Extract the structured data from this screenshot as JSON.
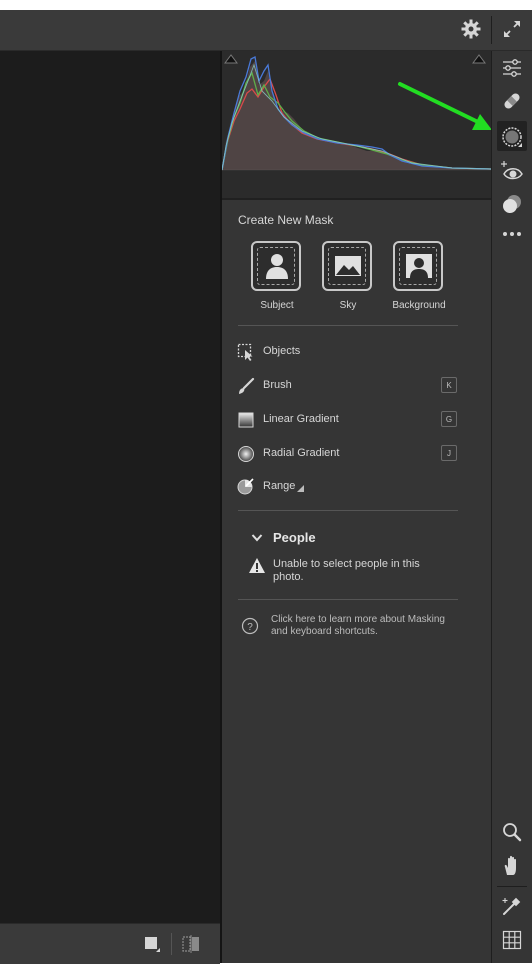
{
  "mask_panel": {
    "title": "Create New Mask",
    "quick_masks": [
      {
        "label": "Subject",
        "icon": "subject-icon"
      },
      {
        "label": "Sky",
        "icon": "sky-icon"
      },
      {
        "label": "Background",
        "icon": "background-icon"
      }
    ],
    "tools": [
      {
        "label": "Objects",
        "icon": "objects-icon",
        "shortcut": ""
      },
      {
        "label": "Brush",
        "icon": "brush-icon",
        "shortcut": "K"
      },
      {
        "label": "Linear Gradient",
        "icon": "linear-gradient-icon",
        "shortcut": "G"
      },
      {
        "label": "Radial Gradient",
        "icon": "radial-gradient-icon",
        "shortcut": "J"
      },
      {
        "label": "Range",
        "icon": "range-icon",
        "shortcut": ""
      }
    ],
    "people": {
      "heading": "People",
      "message_line1": "Unable to select people in this",
      "message_line2": "photo."
    },
    "help": {
      "line1": "Click here to learn more about Masking",
      "line2": "and keyboard shortcuts."
    }
  },
  "right_toolbar": {
    "items": [
      "edit-sliders-icon",
      "healing-icon",
      "masking-icon",
      "red-eye-icon",
      "presets-icon",
      "more-icon",
      "zoom-icon",
      "hand-icon",
      "sampler-icon",
      "grid-icon"
    ],
    "active": "masking-icon"
  },
  "colors": {
    "annotation_arrow": "#22dd22",
    "panel_bg": "#353535",
    "canvas_bg": "#1c1c1c"
  }
}
